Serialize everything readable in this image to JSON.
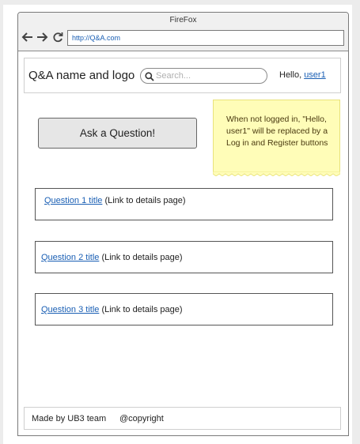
{
  "browser": {
    "window_title": "FireFox",
    "url": "http://Q&A.com",
    "back_glyph": "🡐",
    "forward_glyph": "🡒",
    "reload_glyph": "⟳"
  },
  "header": {
    "brand": "Q&A name and logo",
    "search_placeholder": "Search...",
    "greeting_prefix": "Hello, ",
    "username": "user1"
  },
  "note": {
    "text": "When not logged in, \"Hello, user1\" will be replaced by a Log in and Register buttons",
    "color": "#fffdb8"
  },
  "ask_button": {
    "label": "Ask a Question!"
  },
  "questions": [
    {
      "title": "Question 1 title",
      "suffix": "(Link to details page)"
    },
    {
      "title": "Question 2 title",
      "suffix": "(Link to details page)"
    },
    {
      "title": "Question 3 title",
      "suffix": "(Link to details page)"
    }
  ],
  "footer": {
    "team": "Made by UB3 team",
    "copyright": "@copyright"
  },
  "colors": {
    "link": "#1a5fb4",
    "button_bg": "#e6e6e6",
    "note_bg": "#fffdb8"
  }
}
